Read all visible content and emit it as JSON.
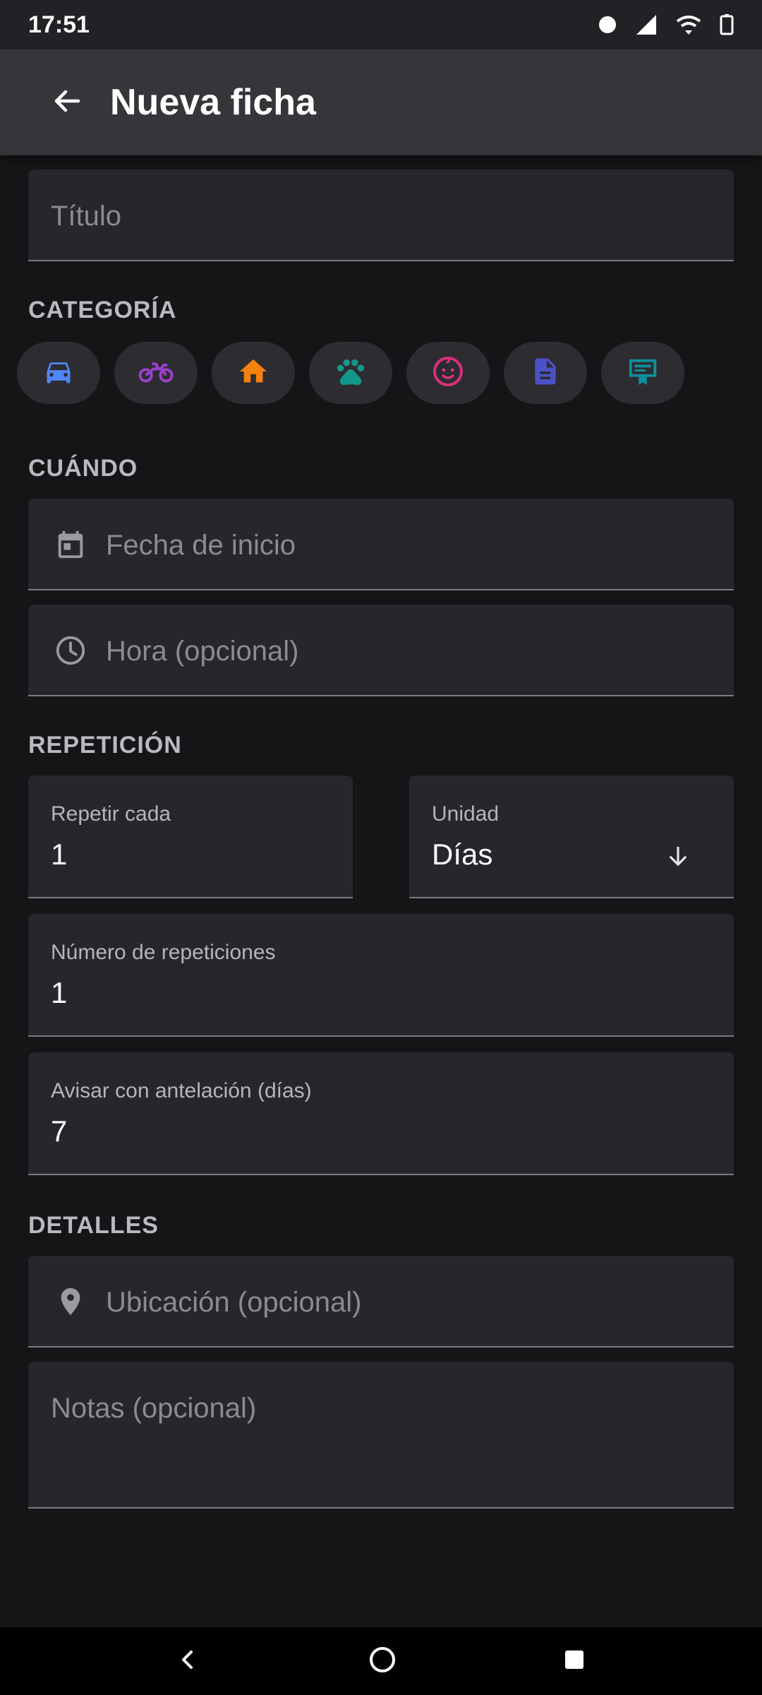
{
  "status_bar": {
    "time": "17:51",
    "icons": [
      "dot-icon",
      "signal-icon",
      "wifi-icon",
      "battery-icon"
    ]
  },
  "app_bar": {
    "title": "Nueva ficha",
    "back_icon": "arrow-left-icon"
  },
  "form": {
    "title_placeholder": "Título",
    "category": {
      "header": "CATEGORÍA",
      "items": [
        {
          "icon": "car-icon",
          "color": "#4f86f7"
        },
        {
          "icon": "motorcycle-icon",
          "color": "#9c3fc9"
        },
        {
          "icon": "home-icon",
          "color": "#f5810f"
        },
        {
          "icon": "paw-icon",
          "color": "#13968a"
        },
        {
          "icon": "baby-icon",
          "color": "#d8307d"
        },
        {
          "icon": "document-icon",
          "color": "#4a52c8"
        },
        {
          "icon": "certificate-icon",
          "color": "#0e8f9c"
        }
      ]
    },
    "when": {
      "header": "CUÁNDO",
      "start_date_placeholder": "Fecha de inicio",
      "time_placeholder": "Hora (opcional)"
    },
    "repetition": {
      "header": "REPETICIÓN",
      "repeat_every_label": "Repetir cada",
      "repeat_every_value": "1",
      "unit_label": "Unidad",
      "unit_value": "Días",
      "count_label": "Número de repeticiones",
      "count_value": "1",
      "notice_label": "Avisar con antelación (días)",
      "notice_value": "7"
    },
    "details": {
      "header": "DETALLES",
      "location_placeholder": "Ubicación (opcional)",
      "notes_placeholder": "Notas (opcional)"
    }
  },
  "nav_bar": {
    "icons": [
      "back-triangle-icon",
      "home-circle-icon",
      "recents-square-icon"
    ]
  }
}
